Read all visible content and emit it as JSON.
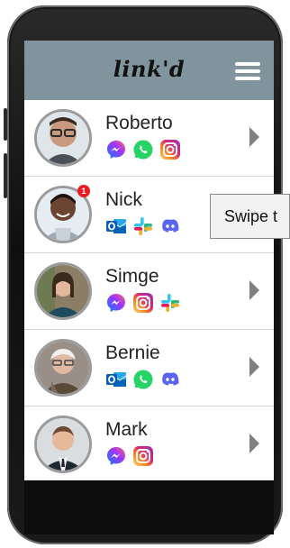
{
  "header": {
    "title": "link'd",
    "menu_icon": "hamburger-menu-icon"
  },
  "contacts": [
    {
      "name": "Roberto",
      "apps": [
        "messenger",
        "whatsapp",
        "instagram"
      ],
      "badge": ""
    },
    {
      "name": "Nick",
      "apps": [
        "outlook",
        "slack",
        "discord"
      ],
      "badge": "1"
    },
    {
      "name": "Simge",
      "apps": [
        "messenger",
        "instagram",
        "slack"
      ],
      "badge": ""
    },
    {
      "name": "Bernie",
      "apps": [
        "outlook",
        "whatsapp",
        "discord"
      ],
      "badge": ""
    },
    {
      "name": "Mark",
      "apps": [
        "messenger",
        "instagram"
      ],
      "badge": ""
    }
  ],
  "tooltip": {
    "text": "Swipe t"
  },
  "colors": {
    "header": "#7f949c",
    "badge": "#ea1c24",
    "chevron": "#808080"
  }
}
